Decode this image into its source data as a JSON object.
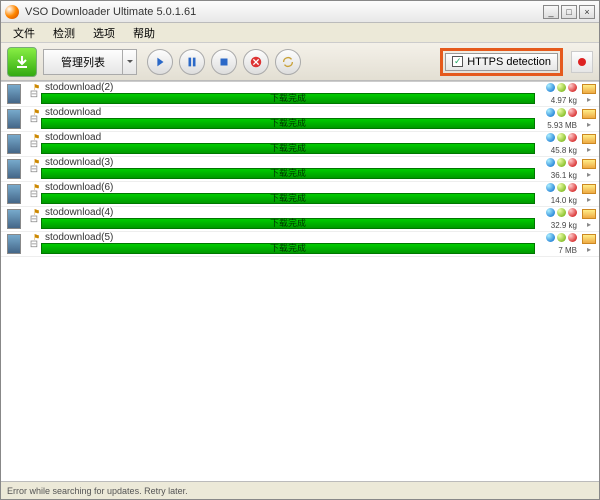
{
  "window": {
    "title": "VSO Downloader Ultimate 5.0.1.61",
    "min": "_",
    "max": "□",
    "close": "×"
  },
  "menu": [
    "文件",
    "检测",
    "选项",
    "帮助"
  ],
  "toolbar": {
    "list_label": "管理列表",
    "https_label": "HTTPS detection"
  },
  "downloads": [
    {
      "name": "stodownload(2)",
      "status": "下载完成",
      "size": "4.97 kg"
    },
    {
      "name": "stodownload",
      "status": "下载完成",
      "size": "5.93 MB"
    },
    {
      "name": "stodownload",
      "status": "下载完成",
      "size": "45.8 kg"
    },
    {
      "name": "stodownload(3)",
      "status": "下载完成",
      "size": "36.1 kg"
    },
    {
      "name": "stodownload(6)",
      "status": "下载完成",
      "size": "14.0 kg"
    },
    {
      "name": "stodownload(4)",
      "status": "下载完成",
      "size": "32.9 kg"
    },
    {
      "name": "stodownload(5)",
      "status": "下载完成",
      "size": "7 MB"
    }
  ],
  "status": "Error while searching for updates. Retry later."
}
